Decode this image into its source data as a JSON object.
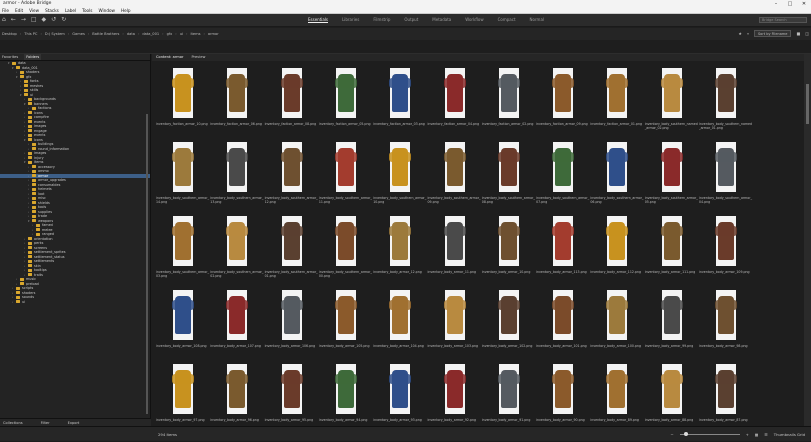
{
  "window": {
    "title": "armor - Adobe Bridge"
  },
  "menu": [
    "File",
    "Edit",
    "View",
    "Stacks",
    "Label",
    "Tools",
    "Window",
    "Help"
  ],
  "workspaces": [
    "Essentials",
    "Libraries",
    "Filmstrip",
    "Output",
    "Metadata",
    "Workflow",
    "Compact",
    "Normal"
  ],
  "active_workspace": "Essentials",
  "search": {
    "placeholder": "Bridge Search"
  },
  "path": [
    "Desktop",
    "This PC",
    "D:) System",
    "Games",
    "Battle Brothers",
    "data",
    "data_001",
    "gfx",
    "ui",
    "items",
    "armor"
  ],
  "sort": {
    "label": "Sort by Filename"
  },
  "left_tabs": [
    "Favorites",
    "Folders"
  ],
  "tree": [
    {
      "d": 2,
      "t": "data",
      "o": true
    },
    {
      "d": 3,
      "t": "data_001",
      "o": true
    },
    {
      "d": 4,
      "t": "shaders",
      "o": false
    },
    {
      "d": 4,
      "t": "gfx",
      "o": true
    },
    {
      "d": 5,
      "t": "fonts",
      "o": false
    },
    {
      "d": 5,
      "t": "meshes",
      "o": false
    },
    {
      "d": 5,
      "t": "skills",
      "o": false
    },
    {
      "d": 5,
      "t": "ui",
      "o": true
    },
    {
      "d": 6,
      "t": "backgrounds",
      "o": false
    },
    {
      "d": 6,
      "t": "banners",
      "o": true
    },
    {
      "d": 7,
      "t": "factions",
      "o": false
    },
    {
      "d": 6,
      "t": "icons",
      "o": false
    },
    {
      "d": 6,
      "t": "campfire",
      "o": false
    },
    {
      "d": 6,
      "t": "events",
      "o": false
    },
    {
      "d": 6,
      "t": "images",
      "o": false
    },
    {
      "d": 6,
      "t": "engage",
      "o": false
    },
    {
      "d": 6,
      "t": "events",
      "o": false
    },
    {
      "d": 6,
      "t": "icons",
      "o": true
    },
    {
      "d": 7,
      "t": "buildings",
      "o": false
    },
    {
      "d": 7,
      "t": "round_information",
      "o": false
    },
    {
      "d": 6,
      "t": "images",
      "o": false
    },
    {
      "d": 6,
      "t": "injury",
      "o": false
    },
    {
      "d": 6,
      "t": "items",
      "o": true
    },
    {
      "d": 7,
      "t": "accessory",
      "o": false
    },
    {
      "d": 7,
      "t": "ammo",
      "o": false
    },
    {
      "d": 7,
      "t": "armor",
      "o": false,
      "sel": true
    },
    {
      "d": 7,
      "t": "armor_upgrades",
      "o": false
    },
    {
      "d": 7,
      "t": "consumables",
      "o": false
    },
    {
      "d": 7,
      "t": "helmets",
      "o": false
    },
    {
      "d": 7,
      "t": "loot",
      "o": false
    },
    {
      "d": 7,
      "t": "misc",
      "o": false
    },
    {
      "d": 7,
      "t": "shields",
      "o": false
    },
    {
      "d": 7,
      "t": "tools",
      "o": false
    },
    {
      "d": 7,
      "t": "supplies",
      "o": false
    },
    {
      "d": 7,
      "t": "trade",
      "o": false
    },
    {
      "d": 7,
      "t": "weapons",
      "o": true
    },
    {
      "d": 8,
      "t": "famed",
      "o": false
    },
    {
      "d": 8,
      "t": "melee",
      "o": false
    },
    {
      "d": 8,
      "t": "ranged",
      "o": false
    },
    {
      "d": 6,
      "t": "orientation",
      "o": false
    },
    {
      "d": 6,
      "t": "perks",
      "o": false
    },
    {
      "d": 6,
      "t": "screens",
      "o": false
    },
    {
      "d": 6,
      "t": "settlement_sprites",
      "o": false
    },
    {
      "d": 6,
      "t": "settlement_status",
      "o": false
    },
    {
      "d": 6,
      "t": "settlements",
      "o": false
    },
    {
      "d": 6,
      "t": "skin",
      "o": false
    },
    {
      "d": 6,
      "t": "tooltips",
      "o": false
    },
    {
      "d": 6,
      "t": "traits",
      "o": false
    },
    {
      "d": 4,
      "t": "music",
      "o": false
    },
    {
      "d": 4,
      "t": "preload",
      "o": false
    },
    {
      "d": 3,
      "t": "scripts",
      "o": false
    },
    {
      "d": 3,
      "t": "shaders",
      "o": false
    },
    {
      "d": 3,
      "t": "sounds",
      "o": false
    },
    {
      "d": 3,
      "t": "ui",
      "o": false
    }
  ],
  "bottom_tabs": [
    "Collections",
    "Filter",
    "Export"
  ],
  "content_tabs": [
    "Content: armor",
    "Preview"
  ],
  "files": [
    "inventory_faction_armor_10.png",
    "inventory_faction_armor_06.png",
    "inventory_faction_armor_08.png",
    "inventory_faction_armor_05.png",
    "inventory_faction_armor_03.png",
    "inventory_faction_armor_04.png",
    "inventory_faction_armor_02.png",
    "inventory_faction_armor_09.png",
    "inventory_faction_armor_01.png",
    "inventory_body_southern_named_armor_02.png",
    "inventory_body_southern_named_armor_01.png",
    "",
    "inventory_body_southern_armor_14.png",
    "inventory_body_southern_armor_13.png",
    "inventory_body_southern_armor_12.png",
    "inventory_body_southern_armor_11.png",
    "inventory_body_southern_armor_10.png",
    "inventory_body_southern_armor_09.png",
    "inventory_body_southern_armor_08.png",
    "inventory_body_southern_armor_07.png",
    "inventory_body_southern_armor_06.png",
    "inventory_body_southern_armor_05.png",
    "inventory_body_southern_armor_04.png",
    "",
    "inventory_body_southern_armor_03.png",
    "inventory_body_southern_armor_02.png",
    "inventory_body_southern_armor_01.png",
    "inventory_body_southern_armor_00.png",
    "inventory_body_armor_12.png",
    "inventory_body_armor_11.png",
    "inventory_body_armor_10.png",
    "inventory_body_armor_113.png",
    "inventory_body_armor_112.png",
    "inventory_body_armor_111.png",
    "inventory_body_armor_109.png",
    "",
    "inventory_body_armor_108.png",
    "inventory_body_armor_107.png",
    "inventory_body_armor_106.png",
    "inventory_body_armor_105.png",
    "inventory_body_armor_104.png",
    "inventory_body_armor_103.png",
    "inventory_body_armor_102.png",
    "inventory_body_armor_101.png",
    "inventory_body_armor_100.png",
    "inventory_body_armor_99.png",
    "inventory_body_armor_98.png",
    "",
    "inventory_body_armor_97.png",
    "inventory_body_armor_96.png",
    "inventory_body_armor_95.png",
    "inventory_body_armor_94.png",
    "inventory_body_armor_93.png",
    "inventory_body_armor_92.png",
    "inventory_body_armor_91.png",
    "inventory_body_armor_90.png",
    "inventory_body_armor_89.png",
    "inventory_body_armor_88.png",
    "inventory_body_armor_87.png",
    ""
  ],
  "armor_colors": [
    "#c8921f",
    "#7a5a2e",
    "#6a3b2a",
    "#3e6a3a",
    "#2f4f8a",
    "#8a2a2a",
    "#555a60",
    "#8b5a2b",
    "#a07030",
    "#b88a40",
    "#5a4030",
    "#7b4b2a",
    "#9c7a3c",
    "#4a4a4a",
    "#6e5030",
    "#a33c2e"
  ],
  "status": {
    "count": "294 items",
    "view_label": "Thumbnails Grid"
  }
}
